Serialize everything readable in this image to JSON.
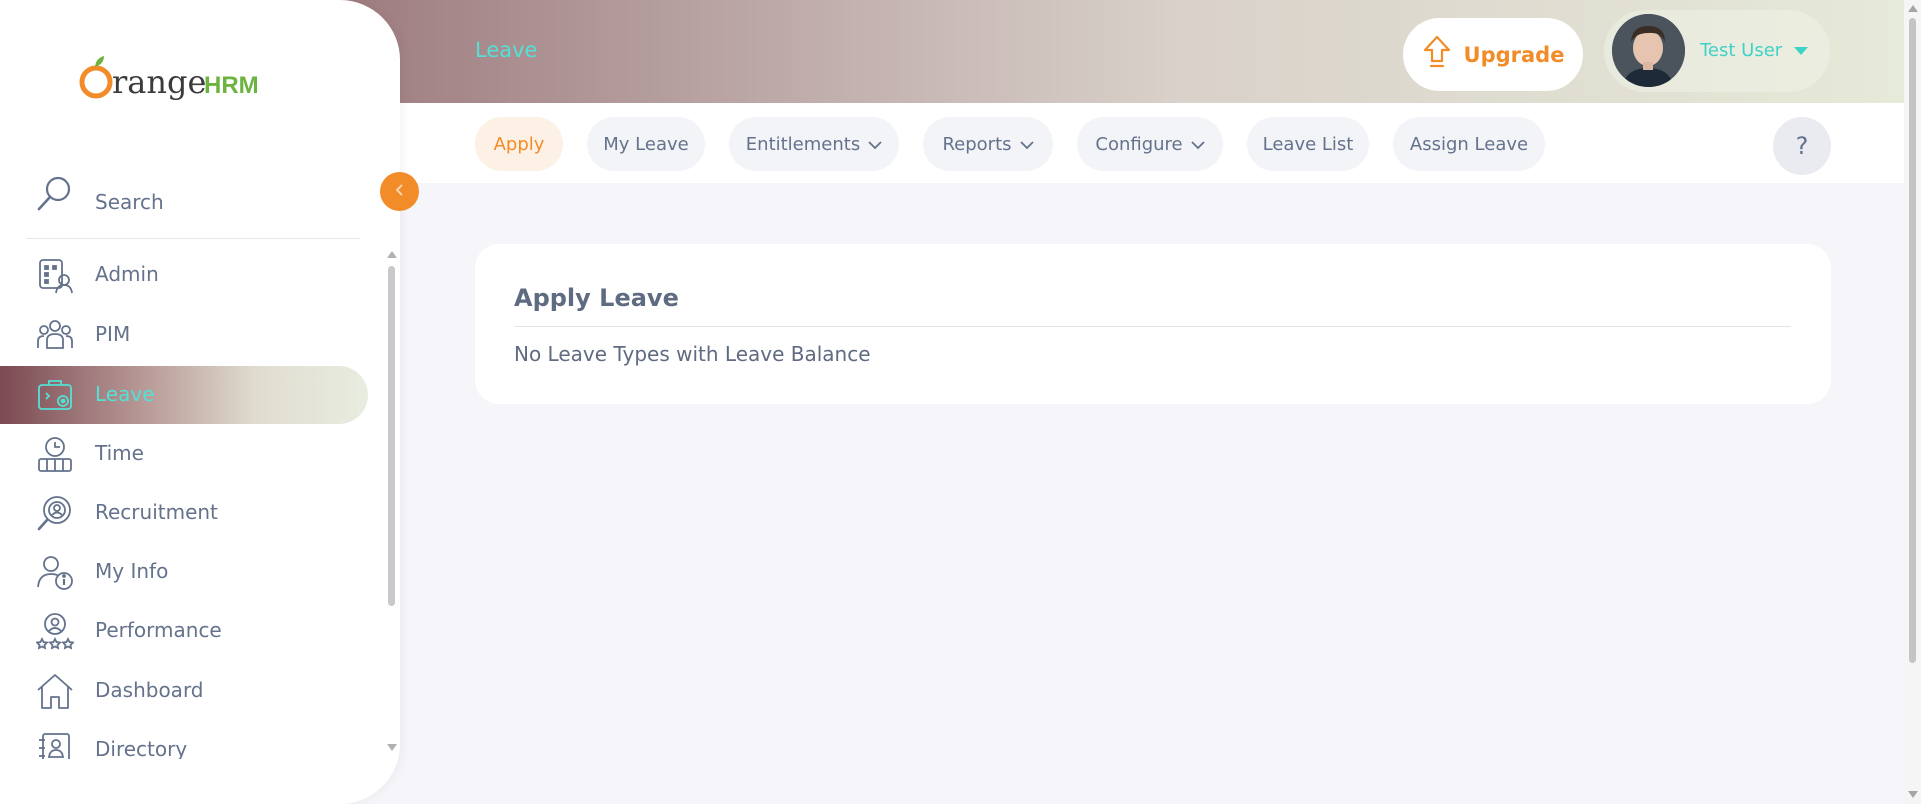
{
  "header": {
    "title": "Leave",
    "upgrade_label": "Upgrade",
    "user_name": "Test User"
  },
  "subnav": {
    "tabs": [
      {
        "label": "Apply",
        "active": true,
        "dropdown": false
      },
      {
        "label": "My Leave",
        "active": false,
        "dropdown": false
      },
      {
        "label": "Entitlements",
        "active": false,
        "dropdown": true
      },
      {
        "label": "Reports",
        "active": false,
        "dropdown": true
      },
      {
        "label": "Configure",
        "active": false,
        "dropdown": true
      },
      {
        "label": "Leave List",
        "active": false,
        "dropdown": false
      },
      {
        "label": "Assign Leave",
        "active": false,
        "dropdown": false
      }
    ],
    "help_label": "?"
  },
  "card": {
    "title": "Apply Leave",
    "message": "No Leave Types with Leave Balance"
  },
  "sidebar": {
    "logo_prefix": "range",
    "logo_suffix": "HRM",
    "search_label": "Search",
    "items": [
      {
        "label": "Admin",
        "icon": "admin-icon",
        "active": false
      },
      {
        "label": "PIM",
        "icon": "pim-icon",
        "active": false
      },
      {
        "label": "Leave",
        "icon": "leave-icon",
        "active": true
      },
      {
        "label": "Time",
        "icon": "time-icon",
        "active": false
      },
      {
        "label": "Recruitment",
        "icon": "recruitment-icon",
        "active": false
      },
      {
        "label": "My Info",
        "icon": "my-info-icon",
        "active": false
      },
      {
        "label": "Performance",
        "icon": "performance-icon",
        "active": false
      },
      {
        "label": "Dashboard",
        "icon": "dashboard-icon",
        "active": false
      },
      {
        "label": "Directory",
        "icon": "directory-icon",
        "active": false
      }
    ]
  },
  "colors": {
    "brand_orange": "#f28c28",
    "accent_teal": "#55e0d5",
    "text_gray": "#64728c"
  }
}
